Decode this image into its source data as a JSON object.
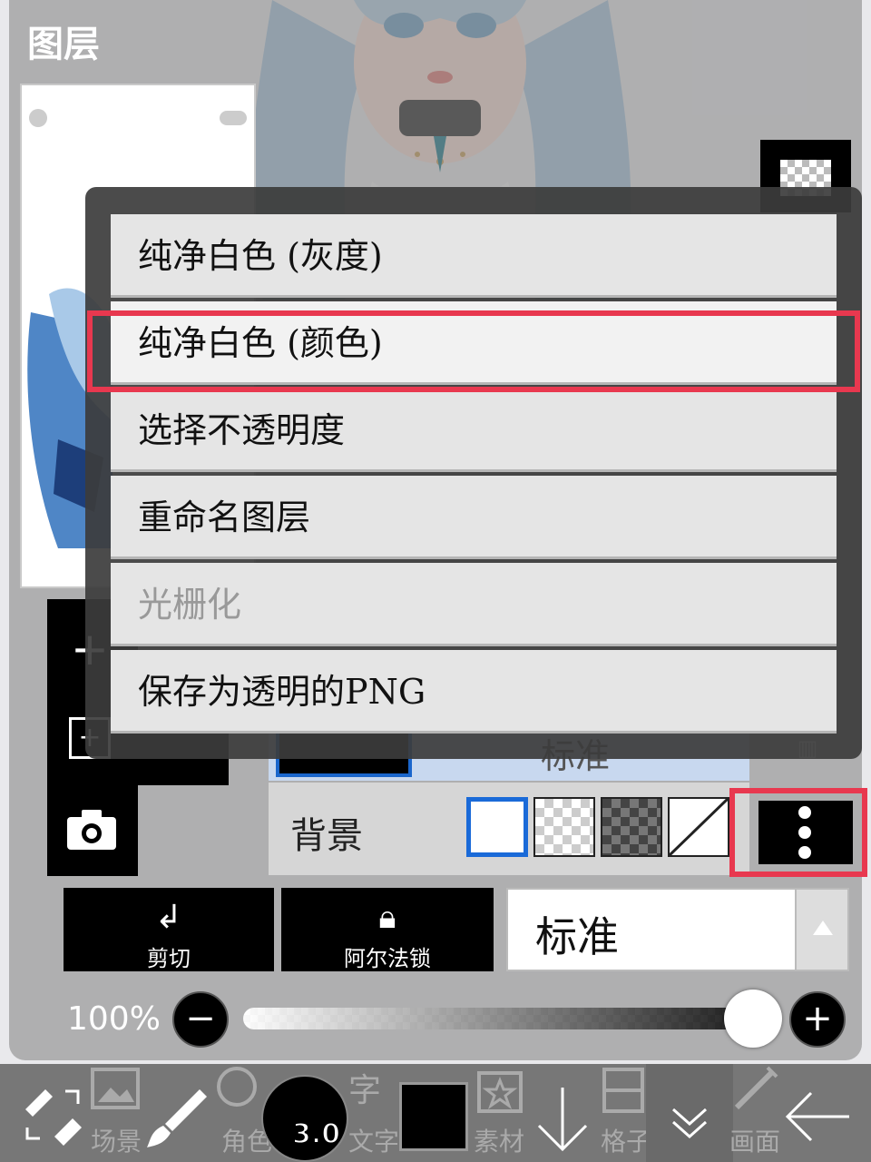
{
  "panel": {
    "title": "图层"
  },
  "context_menu": {
    "items": [
      {
        "label": "纯净白色 (灰度)",
        "enabled": true
      },
      {
        "label": "纯净白色 (颜色)",
        "enabled": true,
        "highlighted": true
      },
      {
        "label": "选择不透明度",
        "enabled": true
      },
      {
        "label": "重命名图层",
        "enabled": true
      },
      {
        "label": "光栅化",
        "enabled": false
      },
      {
        "label": "保存为透明的PNG",
        "enabled": true
      }
    ]
  },
  "layer_row": {
    "blend_mode": "标准"
  },
  "background_row": {
    "label": "背景",
    "swatches": [
      "white",
      "transparent",
      "dark-checker",
      "none"
    ],
    "selected": "white"
  },
  "actions": {
    "clipping_label": "剪切",
    "alpha_lock_label": "阿尔法锁"
  },
  "blend_select": {
    "value": "标准"
  },
  "opacity": {
    "label": "100%",
    "value": 1.0
  },
  "bottom_bar": {
    "scene_label": "场景",
    "character_label": "角色",
    "brush_size": "3.0",
    "text_label": "文字",
    "material_label": "素材",
    "grid_label": "格子",
    "canvas_label": "画面"
  },
  "colors": {
    "highlight": "#e8384f",
    "selection_blue": "#1a66cc",
    "menu_bg": "#e5e5e5"
  }
}
